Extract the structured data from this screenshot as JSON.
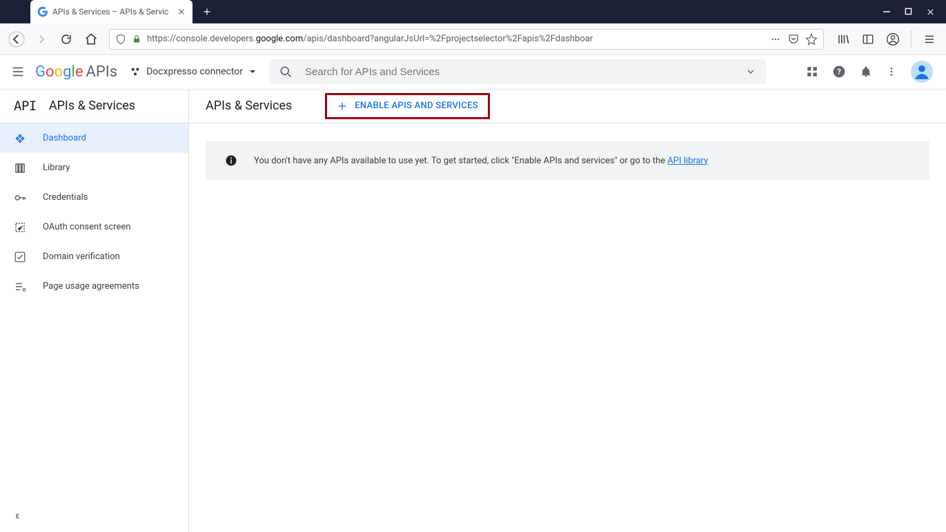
{
  "tab": {
    "title": "APIs & Services – APIs & Servic"
  },
  "url": {
    "scheme_host_pre": "https://console.developers.",
    "scheme_host_strong": "google.com",
    "path": "/apis/dashboard?angularJsUrl=%2Fprojectselector%2Fapis%2Fdashboar"
  },
  "brand": {
    "apis": "APIs"
  },
  "project": {
    "name": "Docxpresso connector"
  },
  "search": {
    "placeholder": "Search for APIs and Services"
  },
  "sidebar": {
    "title": "APIs & Services",
    "items": [
      {
        "label": "Dashboard"
      },
      {
        "label": "Library"
      },
      {
        "label": "Credentials"
      },
      {
        "label": "OAuth consent screen"
      },
      {
        "label": "Domain verification"
      },
      {
        "label": "Page usage agreements"
      }
    ]
  },
  "page": {
    "title": "APIs & Services",
    "enable_button": "ENABLE APIS AND SERVICES"
  },
  "banner": {
    "text": "You don't have any APIs available to use yet. To get started, click \"Enable APIs and services\" or go to the ",
    "link": "API library"
  }
}
